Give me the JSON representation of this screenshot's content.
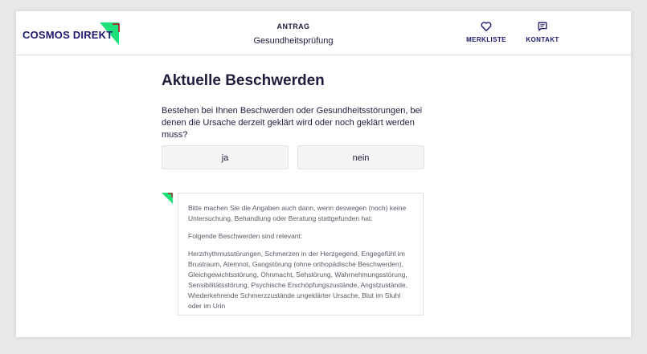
{
  "brand": {
    "name": "COSMOS DIREKT",
    "accent": "#1fe17a",
    "accent_dark": "#b5121b",
    "text_color": "#1a1a6e"
  },
  "header": {
    "eyebrow": "ANTRAG",
    "title": "Gesundheitsprüfung",
    "nav": [
      {
        "label": "MERKLISTE",
        "icon": "heart-icon"
      },
      {
        "label": "KONTAKT",
        "icon": "chat-icon"
      }
    ]
  },
  "main": {
    "heading": "Aktuelle Beschwerden",
    "question": "Bestehen bei Ihnen Beschwerden oder Gesundheitsstörungen, bei denen die Ursache derzeit geklärt wird oder noch geklärt werden muss?",
    "answers": [
      "ja",
      "nein"
    ]
  },
  "info": {
    "paragraph1": "Bitte machen Sie die Angaben auch dann, wenn deswegen (noch) keine Untersuchung, Behandlung oder Beratung stattgefunden hat.",
    "paragraph2": "Folgende Beschwerden sind relevant:",
    "paragraph3": "Herzrhythmusstörungen, Schmerzen in der Herzgegend, Engegefühl im Brustraum, Atemnot, Gangstörung (ohne orthopädische Beschwerden), Gleichgewichtsstörung, Ohnmacht, Sehstörung, Wahrnehmungsstörung, Sensibilitätsstörung, Psychische Erschöpfungszustände, Angstzustände, Wiederkehrende Schmerzzustände ungeklärter Ursache, Blut im Stuhl oder im Urin"
  }
}
